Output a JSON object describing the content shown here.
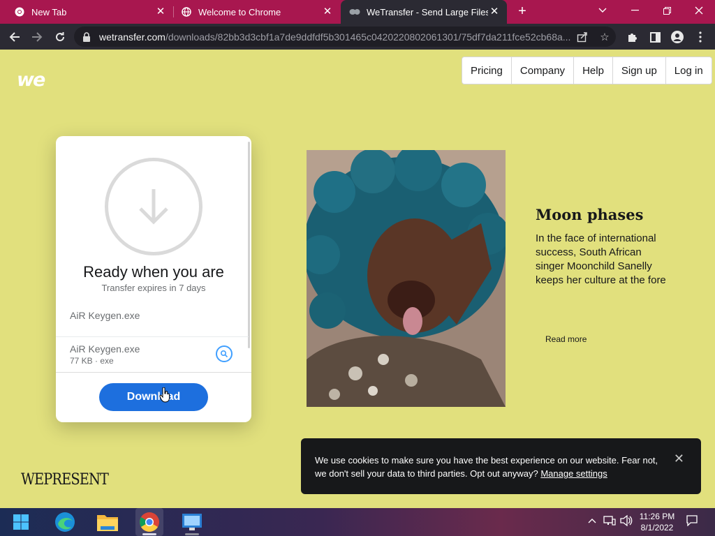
{
  "browser": {
    "tabs": [
      {
        "title": "New Tab",
        "icon": "chrome-icon"
      },
      {
        "title": "Welcome to Chrome",
        "icon": "globe-icon"
      },
      {
        "title": "WeTransfer - Send Large Files & Share Photos Online",
        "icon": "wetransfer-icon",
        "active": true
      }
    ],
    "new_tab": "+",
    "url_host": "wetransfer.com",
    "url_path": "/downloads/82bb3d3cbf1a7de9ddfdf5b301465c0420220802061301/75df7da211fce52cb68a..."
  },
  "site": {
    "logo": "we",
    "nav": [
      "Pricing",
      "Company",
      "Help",
      "Sign up",
      "Log in"
    ]
  },
  "transfer": {
    "title": "Ready when you are",
    "subtitle": "Transfer expires in 7 days",
    "message": "AiR Keygen.exe",
    "file": {
      "name": "AiR Keygen.exe",
      "meta": "77 KB · exe"
    },
    "download_label": "Download"
  },
  "article": {
    "title": "Moon phases",
    "body": "In the face of international success, South African singer Moonchild Sanelly keeps her culture at the fore",
    "read_more": "Read more",
    "brand": "WEPRESENT"
  },
  "cookie": {
    "text": "We use cookies to make sure you have the best experience on our website. Fear not, we don't sell your data to third parties. Opt out anyway?",
    "link": "Manage settings",
    "close": "✕"
  },
  "taskbar": {
    "apps": [
      "start-icon",
      "edge-icon",
      "file-explorer-icon",
      "chrome-icon",
      "remote-desktop-icon"
    ],
    "time": "11:26 PM",
    "date": "8/1/2022"
  },
  "colors": {
    "page_bg": "#e1e07d",
    "tab_strip": "#a8174f",
    "download_button": "#1d6fde",
    "cookie_bg": "#17181a"
  }
}
